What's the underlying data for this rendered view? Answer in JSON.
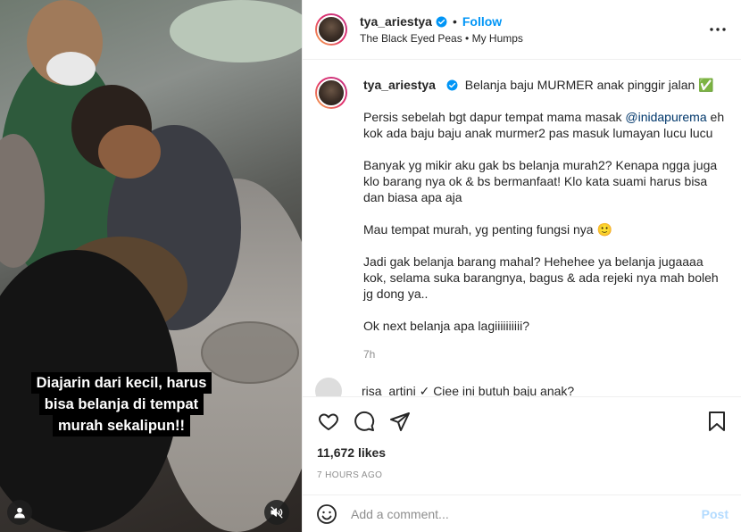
{
  "post": {
    "username": "tya_ariestya",
    "follow_label": "Follow",
    "dot": "•",
    "audio": "The Black Eyed Peas • My Humps"
  },
  "media": {
    "caption_lines": [
      "Diajarin dari kecil, harus",
      "bisa belanja di tempat",
      "murah sekalipun!!"
    ],
    "user_tag_icon": "person-icon",
    "mute_icon": "muted-speaker-icon"
  },
  "caption": {
    "username": "tya_ariestya",
    "title": "Belanja baju MURMER anak pinggir jalan ✅",
    "p1_before": "Persis sebelah bgt dapur tempat mama masak ",
    "p1_mention": "@inidapurema",
    "p1_after": " eh kok ada baju baju anak murmer2 pas masuk lumayan lucu lucu",
    "p2": "Banyak yg mikir aku gak bs belanja murah2? Kenapa ngga juga klo barang nya ok & bs bermanfaat! Klo kata suami harus bisa dan biasa apa aja",
    "p3": "Mau tempat murah, yg penting fungsi nya 🙂",
    "p4": "Jadi gak belanja barang mahal? Hehehee ya belanja jugaaaa kok, selama suka barangnya, bagus & ada rejeki nya mah boleh jg dong ya..",
    "p5": "Ok next belanja apa lagiiiiiiiiii?",
    "age": "7h"
  },
  "comment_peek": {
    "text": "risa_artini ✓ Ciee ini butuh baju anak?"
  },
  "actions": {
    "icons": [
      "heart-icon",
      "comment-icon",
      "share-icon",
      "bookmark-icon"
    ],
    "likes": "11,672 likes",
    "time": "7 HOURS AGO"
  },
  "comment_bar": {
    "placeholder": "Add a comment...",
    "post_label": "Post"
  },
  "colors": {
    "link": "#0095f6",
    "mention": "#00376b",
    "muted": "#8e8e8e",
    "post_disabled": "#b3dbff"
  }
}
